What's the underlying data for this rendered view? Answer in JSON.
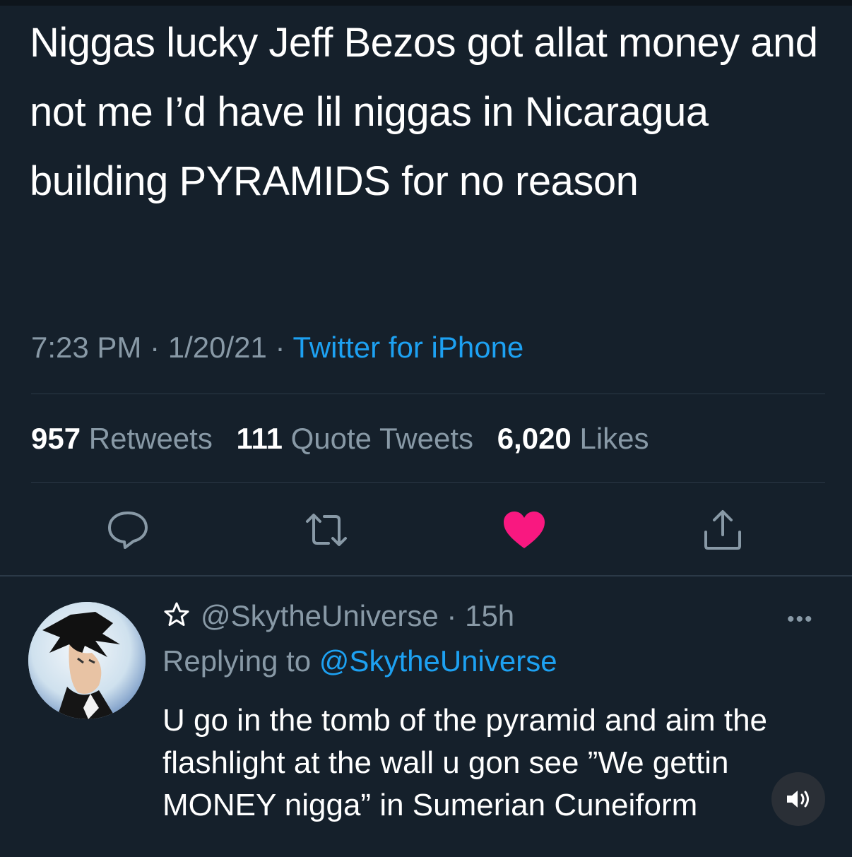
{
  "tweet": {
    "text": "Niggas lucky Jeff Bezos got allat money and not me I’d have lil niggas in Nicaragua building PYRAMIDS for no reason",
    "time": "7:23 PM",
    "separator": " · ",
    "date": "1/20/21",
    "source": "Twitter for iPhone",
    "stats": {
      "retweets_count": "957",
      "retweets_label": "Retweets",
      "quotes_count": "111",
      "quotes_label": "Quote Tweets",
      "likes_count": "6,020",
      "likes_label": "Likes"
    },
    "liked": true,
    "colors": {
      "like": "#f91880",
      "link": "#1da1f2",
      "muted": "#8899a6",
      "background": "#15202b"
    }
  },
  "reply": {
    "handle": "@SkytheUniverse",
    "time": " · 15h",
    "replying_prefix": "Replying to ",
    "replying_to": "@SkytheUniverse",
    "text": "U go in the tomb of the pyramid and aim the flashlight at the wall u gon see ”We gettin MONEY nigga” in Sumerian Cuneiform",
    "more_label": "•••"
  },
  "icons": {
    "reply": "reply-icon",
    "retweet": "retweet-icon",
    "like": "heart-icon",
    "share": "share-icon",
    "star": "star-icon",
    "sound": "speaker-icon"
  }
}
